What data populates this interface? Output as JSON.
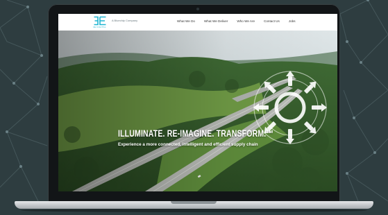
{
  "site": {
    "logo_alt_text": "3E",
    "logo_subtext": "3E DIGITAL",
    "tagline": "A Bluechip Company",
    "nav": [
      {
        "label": "What We Do"
      },
      {
        "label": "What We Deliver"
      },
      {
        "label": "Who We Are"
      },
      {
        "label": "Contact Us"
      },
      {
        "label": "Jobs"
      }
    ]
  },
  "hero": {
    "headline": "ILLUMINATE. RE-IMAGINE. TRANSFORM.™",
    "subheadline": "Experience a more connected, intelligent and efficient supply chain",
    "emblem_icon": "hub-circle-icon"
  },
  "colors": {
    "background": "#2e3d40",
    "brand_cyan": "#1fb5d2",
    "header_bg": "#ffffff",
    "hero_text": "#ffffff"
  }
}
